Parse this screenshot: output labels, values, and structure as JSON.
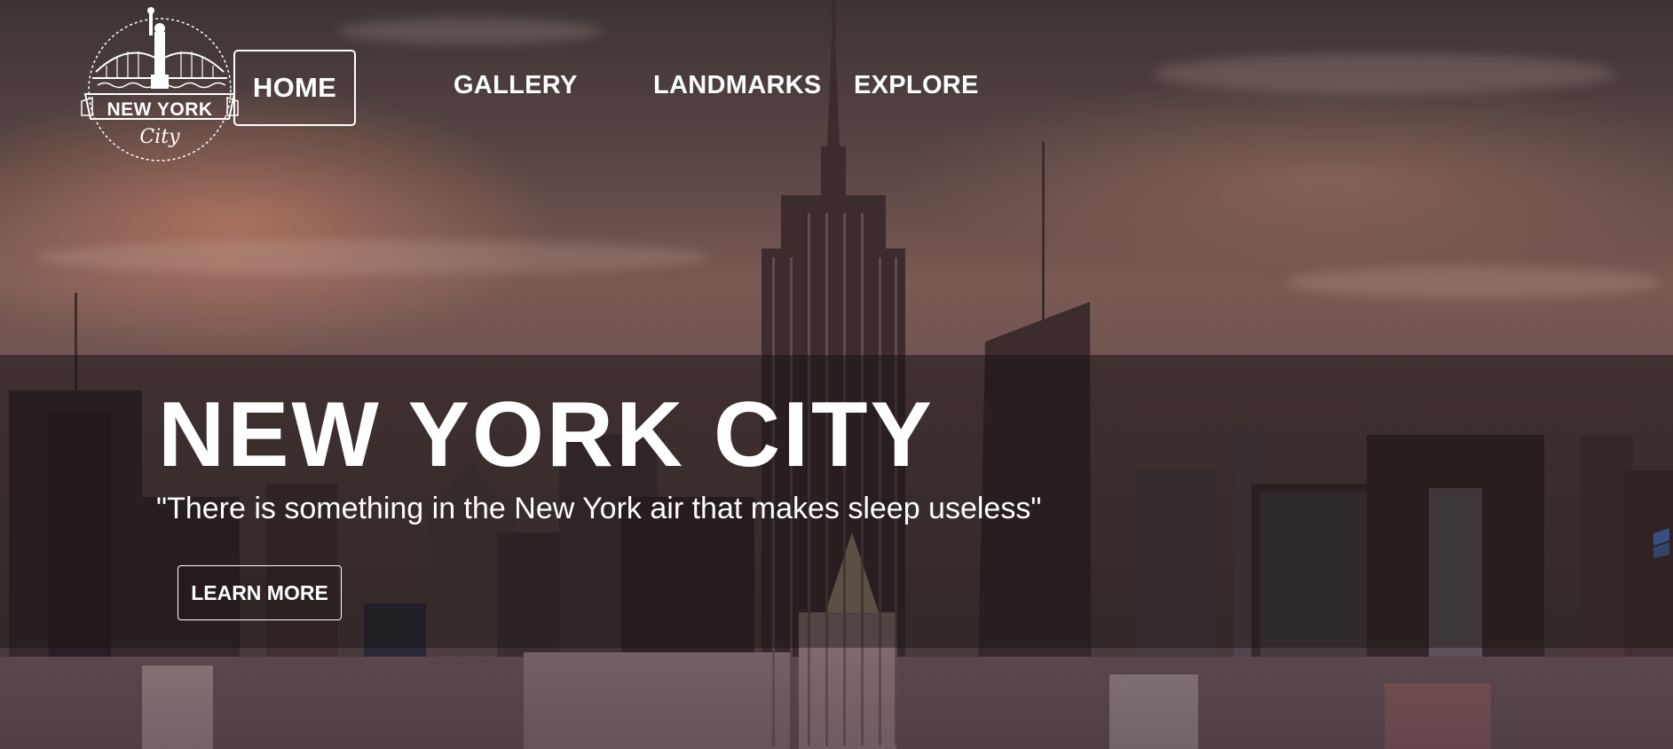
{
  "logo": {
    "line1": "NEW YORK",
    "line2": "City",
    "icon": "statue-of-liberty-bridge-emblem"
  },
  "nav": {
    "items": [
      {
        "label": "HOME",
        "active": true
      },
      {
        "label": "GALLERY",
        "active": false
      },
      {
        "label": "LANDMARKS",
        "active": false
      },
      {
        "label": "EXPLORE",
        "active": false
      }
    ]
  },
  "hero": {
    "title": "NEW YORK CITY",
    "quote": "\"There is something in the New York air that makes sleep useless\"",
    "cta_label": "LEARN MORE"
  },
  "colors": {
    "text": "#ffffff",
    "band": "#19141480",
    "sky_warm": "#7a5a55"
  }
}
